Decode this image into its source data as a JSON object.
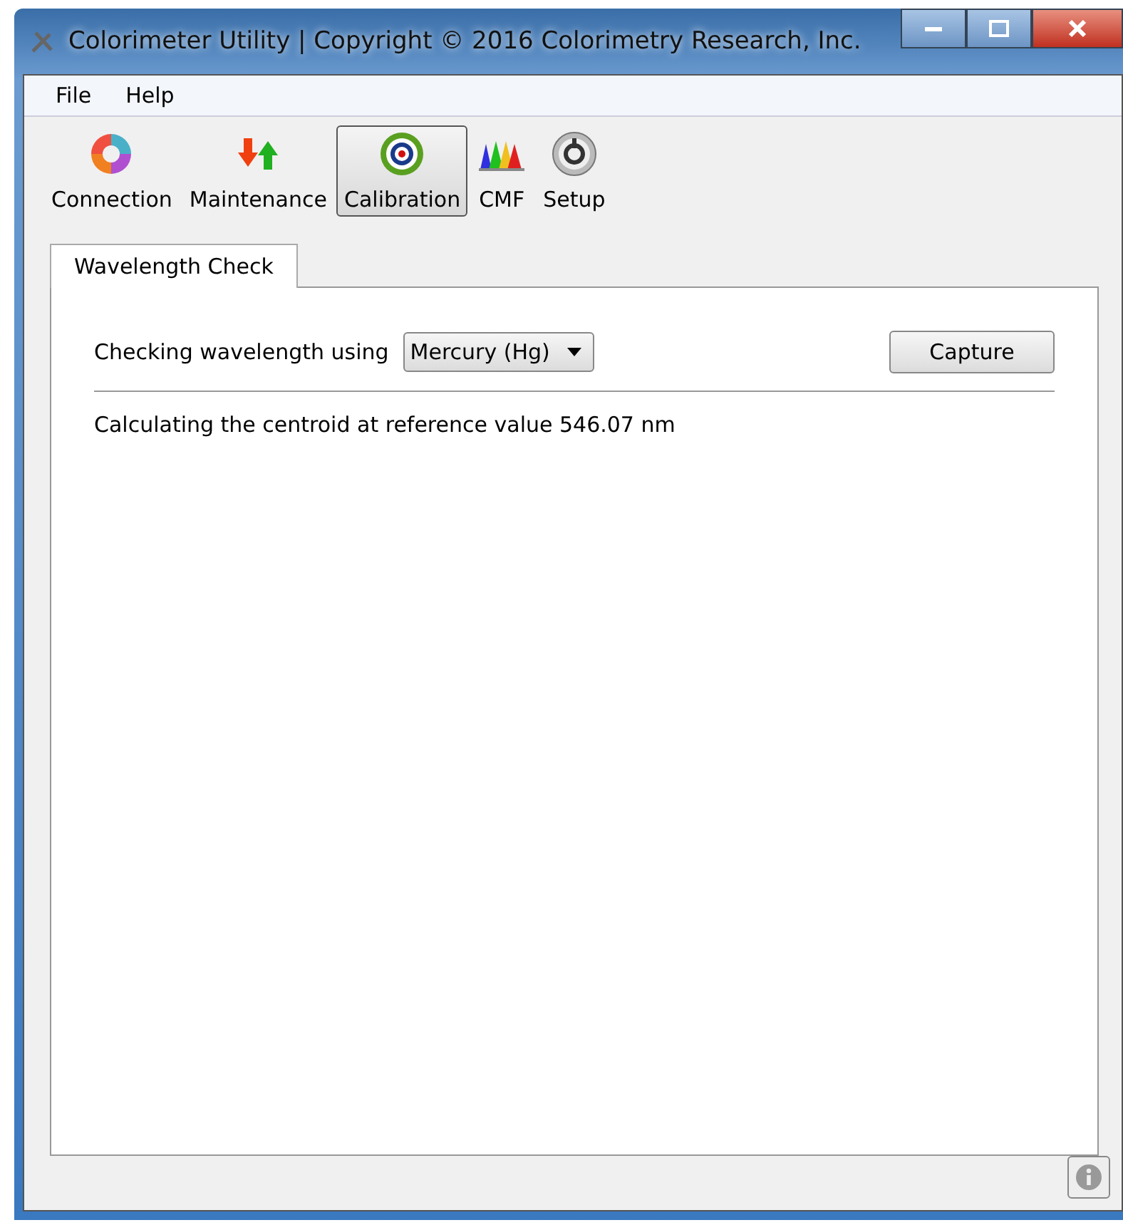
{
  "window": {
    "title": "Colorimeter Utility | Copyright © 2016 Colorimetry Research, Inc."
  },
  "menu": [
    "File",
    "Help"
  ],
  "toolbar": [
    {
      "label": "Connection",
      "kind": "connection",
      "selected": false
    },
    {
      "label": "Maintenance",
      "kind": "maintenance",
      "selected": false
    },
    {
      "label": "Calibration",
      "kind": "calibration",
      "selected": true
    },
    {
      "label": "CMF",
      "kind": "cmf",
      "selected": false
    },
    {
      "label": "Setup",
      "kind": "setup",
      "selected": false
    }
  ],
  "tabs": [
    {
      "label": "Wavelength Check",
      "selected": true
    }
  ],
  "panel": {
    "prompt": "Checking wavelength using",
    "source": {
      "value": "Mercury (Hg)"
    },
    "capture_button": "Capture",
    "status": "Calculating the centroid at reference value 546.07 nm"
  }
}
